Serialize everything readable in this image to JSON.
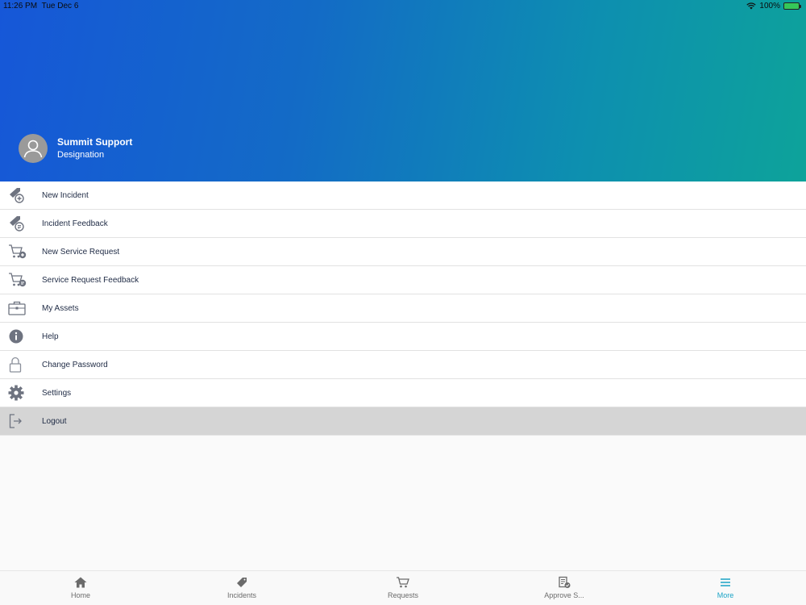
{
  "status": {
    "time": "11:26 PM",
    "date": "Tue Dec 6",
    "battery": "100%"
  },
  "profile": {
    "name": "Summit Support",
    "designation": "Designation"
  },
  "menu": [
    {
      "label": "New Incident",
      "icon": "incident-add-icon"
    },
    {
      "label": "Incident Feedback",
      "icon": "incident-feedback-icon"
    },
    {
      "label": "New Service Request",
      "icon": "cart-add-icon"
    },
    {
      "label": "Service Request Feedback",
      "icon": "cart-feedback-icon"
    },
    {
      "label": "My Assets",
      "icon": "briefcase-icon"
    },
    {
      "label": "Help",
      "icon": "info-icon"
    },
    {
      "label": "Change Password",
      "icon": "lock-icon"
    },
    {
      "label": "Settings",
      "icon": "gear-icon"
    },
    {
      "label": "Logout",
      "icon": "logout-icon"
    }
  ],
  "tabs": [
    {
      "label": "Home",
      "icon": "home-icon"
    },
    {
      "label": "Incidents",
      "icon": "ticket-icon"
    },
    {
      "label": "Requests",
      "icon": "cart-icon"
    },
    {
      "label": "Approve S...",
      "icon": "approve-icon"
    },
    {
      "label": "More",
      "icon": "menu-icon"
    }
  ],
  "colors": {
    "accent": "#1aa3c6",
    "icon": "#6e7380",
    "active_row": "#d5d5d5"
  }
}
